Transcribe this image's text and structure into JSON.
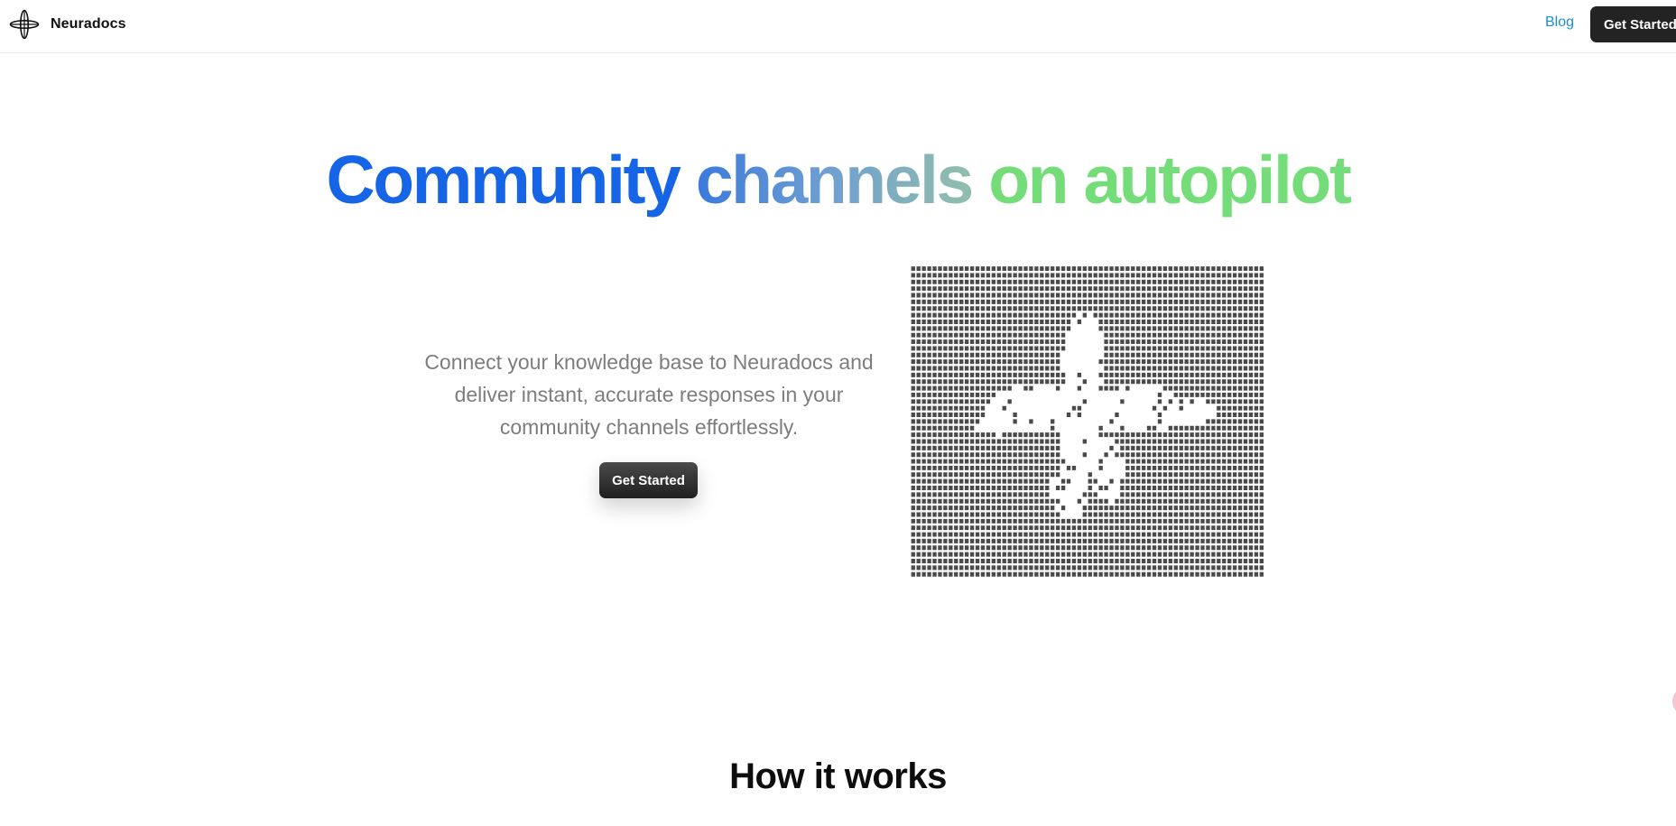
{
  "nav": {
    "brand_name": "Neuradocs",
    "blog_label": "Blog",
    "cta_label": "Get Started"
  },
  "hero": {
    "title_part1": "Community ",
    "title_part2": "channels ",
    "title_part3": "on autopilot",
    "subtitle": "Connect your knowledge base to Neuradocs and deliver instant, accurate responses in your community channels effortlessly.",
    "cta_label": "Get Started"
  },
  "how_it_works": {
    "title": "How it works"
  },
  "colors": {
    "primary_blue": "#1565e6",
    "accent_green": "#74dd79",
    "link_blue": "#1a8fe0",
    "button_dark": "#232323"
  },
  "icons": {
    "brand": "orbit-star-logo-icon"
  }
}
